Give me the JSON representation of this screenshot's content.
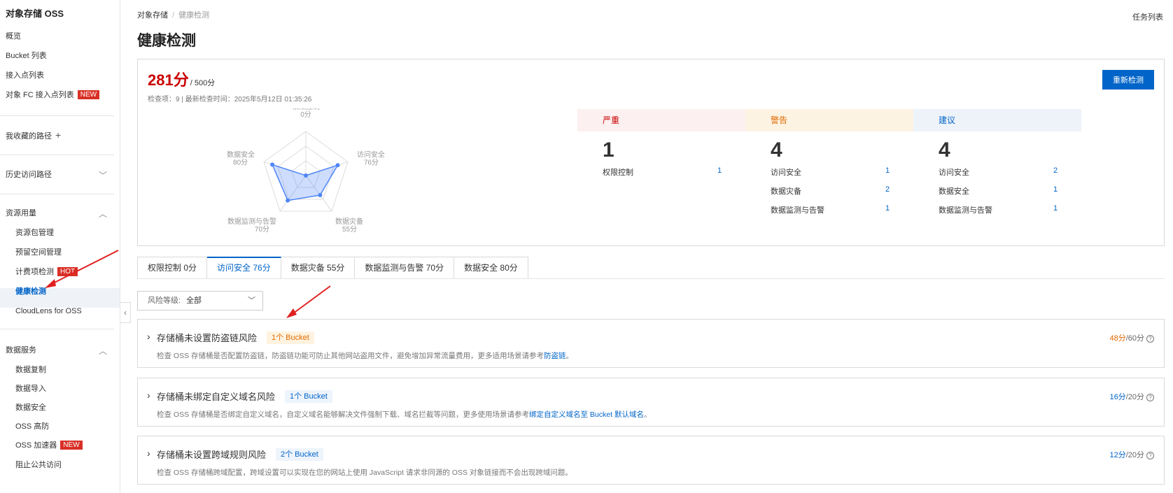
{
  "sidebar": {
    "title": "对象存储 OSS",
    "items": {
      "overview": "概览",
      "bucket_list": "Bucket 列表",
      "access_points": "接入点列表",
      "fc_access_points": "对象 FC 接入点列表",
      "favorites": "我收藏的路径",
      "history": "历史访问路径",
      "resource_usage": "资源用量",
      "resource_pack": "资源包管理",
      "reserved_space": "预留空间管理",
      "billing_check": "计费项检测",
      "health_check": "健康检测",
      "cloudlens": "CloudLens for OSS",
      "data_services": "数据服务",
      "data_replication": "数据复制",
      "data_import": "数据导入",
      "data_security": "数据安全",
      "oss_ddos": "OSS 高防",
      "oss_accelerator": "OSS 加速器",
      "block_public": "阻止公共访问"
    },
    "badges": {
      "new": "NEW",
      "hot": "HOT"
    }
  },
  "breadcrumb": {
    "root": "对象存储",
    "current": "健康检测"
  },
  "task_list": "任务列表",
  "page_title": "健康检测",
  "summary": {
    "score": "281分",
    "max_score": "/ 500分",
    "meta": "检查项：9  |  最新检查时间：2025年5月12日 01:35:26",
    "recheck_button": "重新检测"
  },
  "radar": {
    "axes": [
      {
        "label": "权限控制",
        "score_label": "0分",
        "value": 0
      },
      {
        "label": "访问安全",
        "score_label": "76分",
        "value": 76
      },
      {
        "label": "数据灾备",
        "score_label": "55分",
        "value": 55
      },
      {
        "label": "数据监测与告警",
        "score_label": "70分",
        "value": 70
      },
      {
        "label": "数据安全",
        "score_label": "80分",
        "value": 80
      }
    ],
    "max": 100,
    "fill_color": "#4f86f7"
  },
  "severity": [
    {
      "label": "严重",
      "count": "1",
      "header_bg": "#fdf0f0",
      "header_color": "#c80000",
      "rows": [
        {
          "name": "权限控制",
          "value": "1"
        }
      ]
    },
    {
      "label": "警告",
      "count": "4",
      "header_bg": "#fdf3e3",
      "header_color": "#e06a00",
      "rows": [
        {
          "name": "访问安全",
          "value": "1"
        },
        {
          "name": "数据灾备",
          "value": "2"
        },
        {
          "name": "数据监测与告警",
          "value": "1"
        }
      ]
    },
    {
      "label": "建议",
      "count": "4",
      "header_bg": "#eef3f9",
      "header_color": "#0064c8",
      "rows": [
        {
          "name": "访问安全",
          "value": "2"
        },
        {
          "name": "数据安全",
          "value": "1"
        },
        {
          "name": "数据监测与告警",
          "value": "1"
        }
      ]
    }
  ],
  "tabs": [
    {
      "label": "权限控制 0分",
      "active": false
    },
    {
      "label": "访问安全 76分",
      "active": true
    },
    {
      "label": "数据灾备 55分",
      "active": false
    },
    {
      "label": "数据监测与告警 70分",
      "active": false
    },
    {
      "label": "数据安全 80分",
      "active": false
    }
  ],
  "filter": {
    "label": "风险等级:",
    "value": "全部"
  },
  "risks": [
    {
      "title": "存储桶未设置防盗链风险",
      "tag": "1个 Bucket",
      "level": "warn",
      "desc": "检查 OSS 存储桶是否配置防盗链，防盗链功能可防止其他网站盗用文件，避免增加异常流量费用，更多适用场景请参考",
      "link": "防盗链",
      "desc_end": "。",
      "score_got": "48分",
      "score_total": "/60分"
    },
    {
      "title": "存储桶未绑定自定义域名风险",
      "tag": "1个 Bucket",
      "level": "info",
      "desc": "检查 OSS 存储桶是否绑定自定义域名，自定义域名能够解决文件强制下载、域名拦截等问题，更多使用场景请参考",
      "link": "绑定自定义域名至 Bucket 默认域名",
      "desc_end": "。",
      "score_got": "16分",
      "score_total": "/20分"
    },
    {
      "title": "存储桶未设置跨域规则风险",
      "tag": "2个 Bucket",
      "level": "info",
      "desc": "检查 OSS 存储桶跨域配置，跨域设置可以实现在您的网站上使用 JavaScript 请求非同源的 OSS 对象链接而不会出现跨域问题。",
      "link": "",
      "desc_end": "",
      "score_got": "12分",
      "score_total": "/20分"
    }
  ]
}
